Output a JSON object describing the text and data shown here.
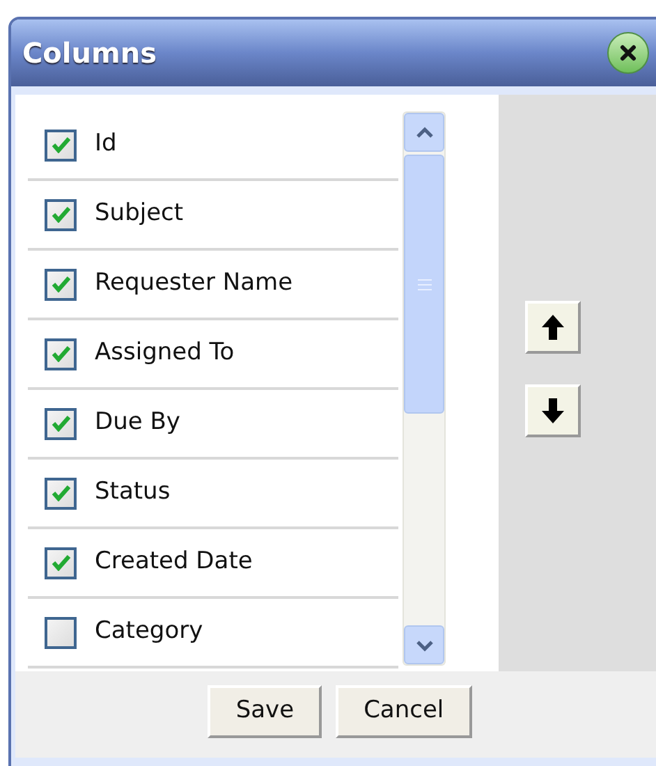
{
  "dialog": {
    "title": "Columns"
  },
  "columns": [
    {
      "label": "Id",
      "checked": true
    },
    {
      "label": "Subject",
      "checked": true
    },
    {
      "label": "Requester Name",
      "checked": true
    },
    {
      "label": "Assigned To",
      "checked": true
    },
    {
      "label": "Due By",
      "checked": true
    },
    {
      "label": "Status",
      "checked": true
    },
    {
      "label": "Created Date",
      "checked": true
    },
    {
      "label": "Category",
      "checked": false
    }
  ],
  "buttons": [
    {
      "label": "Save"
    },
    {
      "label": "Cancel"
    }
  ]
}
